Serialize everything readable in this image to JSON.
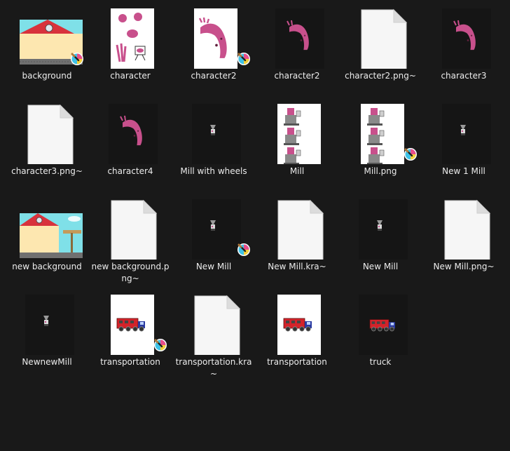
{
  "window": {
    "background": "#191919",
    "text_color": "#ececec"
  },
  "files": [
    {
      "label": "background",
      "thumb": "background",
      "badge": true
    },
    {
      "label": "character",
      "thumb": "character-sheet",
      "badge": false
    },
    {
      "label": "character2",
      "thumb": "pink-worm-white",
      "badge": true
    },
    {
      "label": "character2",
      "thumb": "pink-worm-dark",
      "badge": false
    },
    {
      "label": "character2.png~",
      "thumb": "blank-file",
      "badge": false
    },
    {
      "label": "character3",
      "thumb": "pink-worm-dark",
      "badge": false
    },
    {
      "label": "character3.png~",
      "thumb": "blank-file",
      "badge": false
    },
    {
      "label": "character4",
      "thumb": "pink-worm-dark",
      "badge": false
    },
    {
      "label": "Mill with wheels",
      "thumb": "mill-dark",
      "badge": false
    },
    {
      "label": "Mill",
      "thumb": "mill-strip",
      "badge": false
    },
    {
      "label": "Mill.png",
      "thumb": "mill-strip",
      "badge": true
    },
    {
      "label": "New 1 Mill",
      "thumb": "mill-dark",
      "badge": false
    },
    {
      "label": "new background",
      "thumb": "background-sign",
      "badge": false
    },
    {
      "label": "new background.png~",
      "thumb": "blank-file",
      "badge": false
    },
    {
      "label": "New Mill",
      "thumb": "mill-dark",
      "badge": true
    },
    {
      "label": "New Mill.kra~",
      "thumb": "blank-file",
      "badge": false
    },
    {
      "label": "New Mill",
      "thumb": "mill-dark",
      "badge": false
    },
    {
      "label": "New Mill.png~",
      "thumb": "blank-file",
      "badge": false
    },
    {
      "label": "NewnewMill",
      "thumb": "mill-dark",
      "badge": false
    },
    {
      "label": "transportation",
      "thumb": "truck-white",
      "badge": true
    },
    {
      "label": "transportation.kra~",
      "thumb": "blank-file",
      "badge": false
    },
    {
      "label": "transportation",
      "thumb": "truck-white",
      "badge": false
    },
    {
      "label": "truck",
      "thumb": "truck-dark",
      "badge": false
    }
  ],
  "colors": {
    "sky": "#7fe0e8",
    "house_wall": "#fde7b0",
    "roof": "#d8323c",
    "worm_pink": "#c8508c",
    "truck_red": "#d4232a",
    "truck_cab": "#2a3aa0",
    "file_white": "#f6f6f6",
    "krita_badge": "#e84d8a"
  }
}
